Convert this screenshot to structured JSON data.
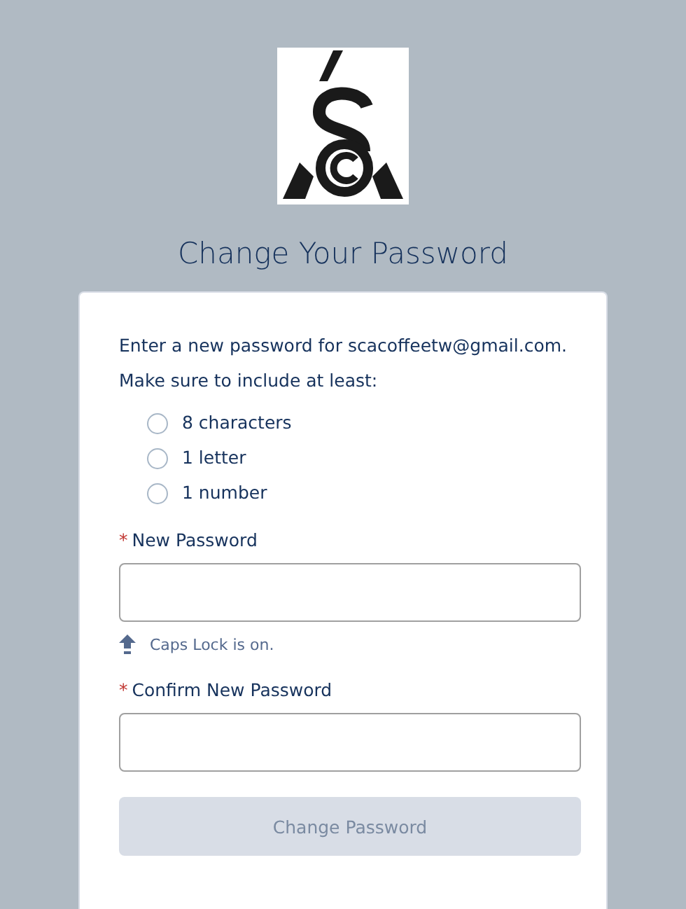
{
  "title": "Change Your Password",
  "intro": "Enter a new password for scacoffeetw@gmail.com.",
  "requirements_heading": "Make sure to include at least:",
  "requirements": [
    {
      "label": "8 characters",
      "met": false
    },
    {
      "label": "1 letter",
      "met": false
    },
    {
      "label": "1 number",
      "met": false
    }
  ],
  "new_password": {
    "required_mark": "*",
    "label": "New Password"
  },
  "caps_lock_warning": "Caps Lock is on.",
  "confirm_password": {
    "required_mark": "*",
    "label": "Confirm New Password"
  },
  "submit": {
    "label": "Change Password",
    "disabled": true
  }
}
